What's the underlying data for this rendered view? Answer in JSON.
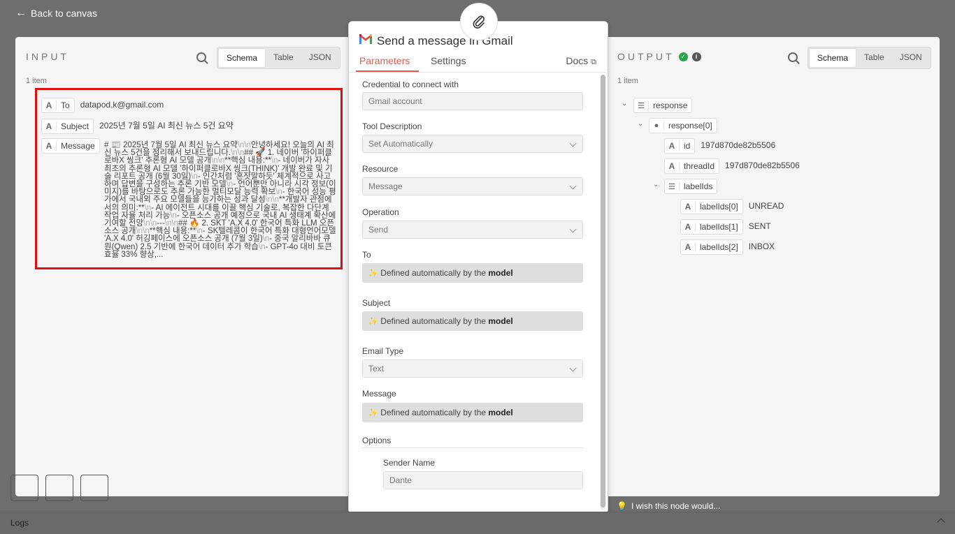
{
  "back_label": "Back to canvas",
  "input": {
    "title": "INPUT",
    "tabs": [
      "Schema",
      "Table",
      "JSON"
    ],
    "active_tab": "Schema",
    "count": "1 item",
    "fields": [
      {
        "key": "To",
        "value": "datapod.k@gmail.com"
      },
      {
        "key": "Subject",
        "value": "2025년 7월 5일 AI 최신 뉴스 5건 요약"
      },
      {
        "key": "Message"
      }
    ],
    "message_segments": [
      "# 📰 2025년 7월 5일 AI 최신 뉴스 요약",
      "\\n\\n",
      "안녕하세요! 오늘의 AI 최신 뉴스 5건을 정리해서 보내드립니다.",
      "\\n\\n",
      "## 🚀 1. 네이버 '하이퍼클로바X 씽크' 추론형 AI 모델 공개",
      "\\n\\n",
      "**핵심 내용:**",
      "\\n",
      "- 네이버가 자사 최초의 추론형 AI 모델 '하이퍼클로바X 씽크(THINK)' 개발 완료 및 기술 리포트 공개 (6월 30일)",
      "\\n",
      "- 인간처럼 '혼잣말하듯' 체계적으로 사고하며 답변을 구성하는 추론 기반 모델",
      "\\n",
      "- 언어뿐만 아니라 시각 정보(이미지)를 바탕으로도 추론 가능한 멀티모달 능력 확보",
      "\\n",
      "- 한국어 성능 평가에서 국내외 주요 모델들을 능가하는 성과 달성",
      "\\n\\n",
      "**개발자 관점에서의 의미:**",
      "\\n",
      "- AI 에이전트 시대를 이끌 핵심 기술로, 복잡한 다단계 작업 자율 처리 가능",
      "\\n",
      "- 오픈소스 공개 예정으로 국내 AI 생태계 확산에 기여할 전망",
      "\\n\\n",
      "---",
      "\\n\\n",
      "## 🔥 2. SKT 'A.X 4.0' 한국어 특화 LLM 오픈소스 공개",
      "\\n\\n",
      "**핵심 내용:**",
      "\\n",
      "- SK텔레콤이 한국어 특화 대형언어모델 'A.X 4.0' 허깅페이스에 오픈소스 공개 (7월 3일)",
      "\\n",
      "- 중국 알리바바 큐원(Qwen) 2.5 기반에 한국어 데이터 추가 학습",
      "\\n",
      "- GPT-4o 대비 토큰 효율 33% 향상,..."
    ]
  },
  "modal": {
    "title": "Send a message in Gmail",
    "tabs": [
      "Parameters",
      "Settings"
    ],
    "docs": "Docs",
    "fields": {
      "credential": {
        "label": "Credential to connect with",
        "value": "Gmail account"
      },
      "tool_description": {
        "label": "Tool Description",
        "value": "Set Automatically"
      },
      "resource": {
        "label": "Resource",
        "value": "Message"
      },
      "operation": {
        "label": "Operation",
        "value": "Send"
      },
      "to": {
        "label": "To"
      },
      "subject": {
        "label": "Subject"
      },
      "email_type": {
        "label": "Email Type",
        "value": "Text"
      },
      "message": {
        "label": "Message"
      },
      "options": {
        "label": "Options"
      },
      "sender_name": {
        "label": "Sender Name",
        "value": "Dante"
      }
    },
    "auto_prefix": "Defined automatically by the",
    "auto_bold": "model"
  },
  "output": {
    "title": "OUTPUT",
    "tabs": [
      "Schema",
      "Table",
      "JSON"
    ],
    "active_tab": "Schema",
    "count": "1 item",
    "response": "response",
    "response0": "response[0]",
    "id_key": "id",
    "id_value": "197d870de82b5506",
    "thread_key": "threadId",
    "thread_value": "197d870de82b5506",
    "labelids": "labelIds",
    "labels": [
      {
        "key": "labelIds[0]",
        "value": "UNREAD"
      },
      {
        "key": "labelIds[1]",
        "value": "SENT"
      },
      {
        "key": "labelIds[2]",
        "value": "INBOX"
      }
    ]
  },
  "wish": "I wish this node would...",
  "logs": "Logs"
}
